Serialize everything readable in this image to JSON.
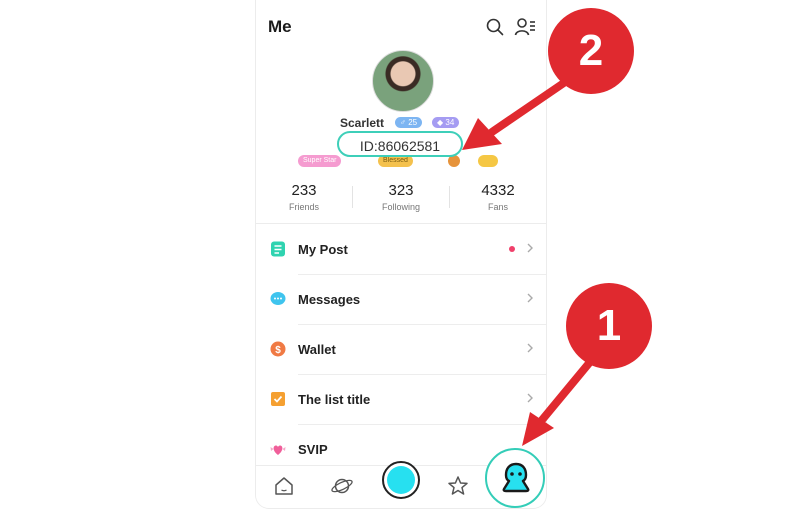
{
  "header": {
    "title": "Me"
  },
  "profile": {
    "username": "Scarlett",
    "level_badge": "25",
    "diamond_badge": "34",
    "id_text": "ID:86062581",
    "badges": [
      "Super Star",
      "Blessed"
    ]
  },
  "stats": [
    {
      "value": "233",
      "label": "Friends"
    },
    {
      "value": "323",
      "label": "Following"
    },
    {
      "value": "4332",
      "label": "Fans"
    }
  ],
  "menu": [
    {
      "label": "My Post",
      "icon": "document-icon",
      "color": "#2fd3b0",
      "has_dot": true
    },
    {
      "label": "Messages",
      "icon": "chat-icon",
      "color": "#3fc4ee",
      "has_dot": false
    },
    {
      "label": "Wallet",
      "icon": "coin-icon",
      "color": "#f07a44",
      "has_dot": false
    },
    {
      "label": "The list title",
      "icon": "checklist-icon",
      "color": "#f5a031",
      "has_dot": false
    },
    {
      "label": "SVIP",
      "icon": "heart-wings-icon",
      "color": "#f05f9a",
      "has_dot": false
    }
  ],
  "tabbar": {
    "tabs": [
      "home-icon",
      "planet-icon",
      "camera-button",
      "star-icon",
      "profile-icon"
    ]
  },
  "annotations": {
    "step1": "1",
    "step2": "2",
    "color": "#e0292f"
  },
  "colors": {
    "accent": "#3ecfb9",
    "camera": "#27e0f0"
  }
}
